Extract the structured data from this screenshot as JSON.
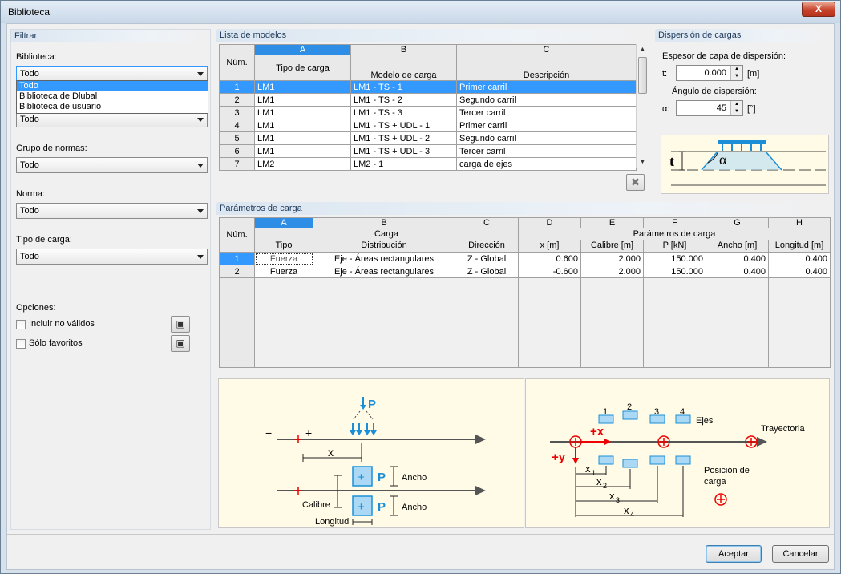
{
  "window": {
    "title": "Biblioteca",
    "close_label": "X"
  },
  "filter": {
    "title": "Filtrar",
    "biblioteca_label": "Biblioteca:",
    "biblioteca_value": "Todo",
    "biblioteca_options": [
      "Todo",
      "Biblioteca de Dlubal",
      "Biblioteca de usuario"
    ],
    "hidden_combo_value": "Todo",
    "grupo_label": "Grupo de normas:",
    "grupo_value": "Todo",
    "norma_label": "Norma:",
    "norma_value": "Todo",
    "tipo_label": "Tipo de carga:",
    "tipo_value": "Todo",
    "opciones_label": "Opciones:",
    "incluir_label": "Incluir no válidos",
    "favoritos_label": "Sólo favoritos"
  },
  "models": {
    "title": "Lista de modelos",
    "col_letters": [
      "A",
      "B",
      "C"
    ],
    "num_header": "Núm.",
    "headers": [
      "Tipo de carga",
      "Modelo de carga",
      "Descripción"
    ],
    "rows": [
      {
        "n": "1",
        "tipo": "LM1",
        "modelo": "LM1 - TS - 1",
        "desc": "Primer carril"
      },
      {
        "n": "2",
        "tipo": "LM1",
        "modelo": "LM1 - TS - 2",
        "desc": "Segundo carril"
      },
      {
        "n": "3",
        "tipo": "LM1",
        "modelo": "LM1 - TS - 3",
        "desc": "Tercer carril"
      },
      {
        "n": "4",
        "tipo": "LM1",
        "modelo": "LM1 - TS + UDL - 1",
        "desc": "Primer carril"
      },
      {
        "n": "5",
        "tipo": "LM1",
        "modelo": "LM1 - TS + UDL - 2",
        "desc": "Segundo carril"
      },
      {
        "n": "6",
        "tipo": "LM1",
        "modelo": "LM1 - TS + UDL - 3",
        "desc": "Tercer carril"
      },
      {
        "n": "7",
        "tipo": "LM2",
        "modelo": "LM2 - 1",
        "desc": "carga de ejes"
      }
    ],
    "selected_row": 0
  },
  "dispersion": {
    "title": "Dispersión de cargas",
    "espesor_label": "Espesor de capa de dispersión:",
    "t_label": "t:",
    "t_value": "0.000",
    "t_unit": "[m]",
    "angulo_label": "Ángulo de dispersión:",
    "a_label": "α:",
    "a_value": "45",
    "a_unit": "[°]",
    "fig_t": "t",
    "fig_alpha": "α"
  },
  "params": {
    "title": "Parámetros de carga",
    "col_letters": [
      "A",
      "B",
      "C",
      "D",
      "E",
      "F",
      "G",
      "H"
    ],
    "num_header": "Núm.",
    "group_carga": "Carga",
    "group_params": "Parámetros de carga",
    "headers": [
      "Tipo",
      "Distribución",
      "Dirección",
      "x [m]",
      "Calibre [m]",
      "P [kN]",
      "Ancho [m]",
      "Longitud [m]"
    ],
    "rows": [
      {
        "n": "1",
        "tipo": "Fuerza",
        "dist": "Eje - Áreas rectangulares",
        "dir": "Z - Global",
        "x": "0.600",
        "cal": "2.000",
        "p": "150.000",
        "ancho": "0.400",
        "long": "0.400"
      },
      {
        "n": "2",
        "tipo": "Fuerza",
        "dist": "Eje - Áreas rectangulares",
        "dir": "Z - Global",
        "x": "-0.600",
        "cal": "2.000",
        "p": "150.000",
        "ancho": "0.400",
        "long": "0.400"
      }
    ]
  },
  "fig_left": {
    "P": "P",
    "minus": "−",
    "plus": "+",
    "x": "x",
    "ancho1": "Ancho",
    "ancho2": "Ancho",
    "calibre": "Calibre",
    "longitud": "Longitud",
    "box_plus": "+"
  },
  "fig_right": {
    "n1": "1",
    "n2": "2",
    "n3": "3",
    "n4": "4",
    "ejes": "Ejes",
    "trayectoria": "Trayectoria",
    "plusx": "+x",
    "plusy": "+y",
    "x1": "x",
    "s1": "1",
    "x2": "x",
    "s2": "2",
    "x3": "x",
    "s3": "3",
    "x4": "x",
    "s4": "4",
    "posicion": "Posición de",
    "carga": "carga"
  },
  "buttons": {
    "accept": "Aceptar",
    "cancel": "Cancelar"
  }
}
